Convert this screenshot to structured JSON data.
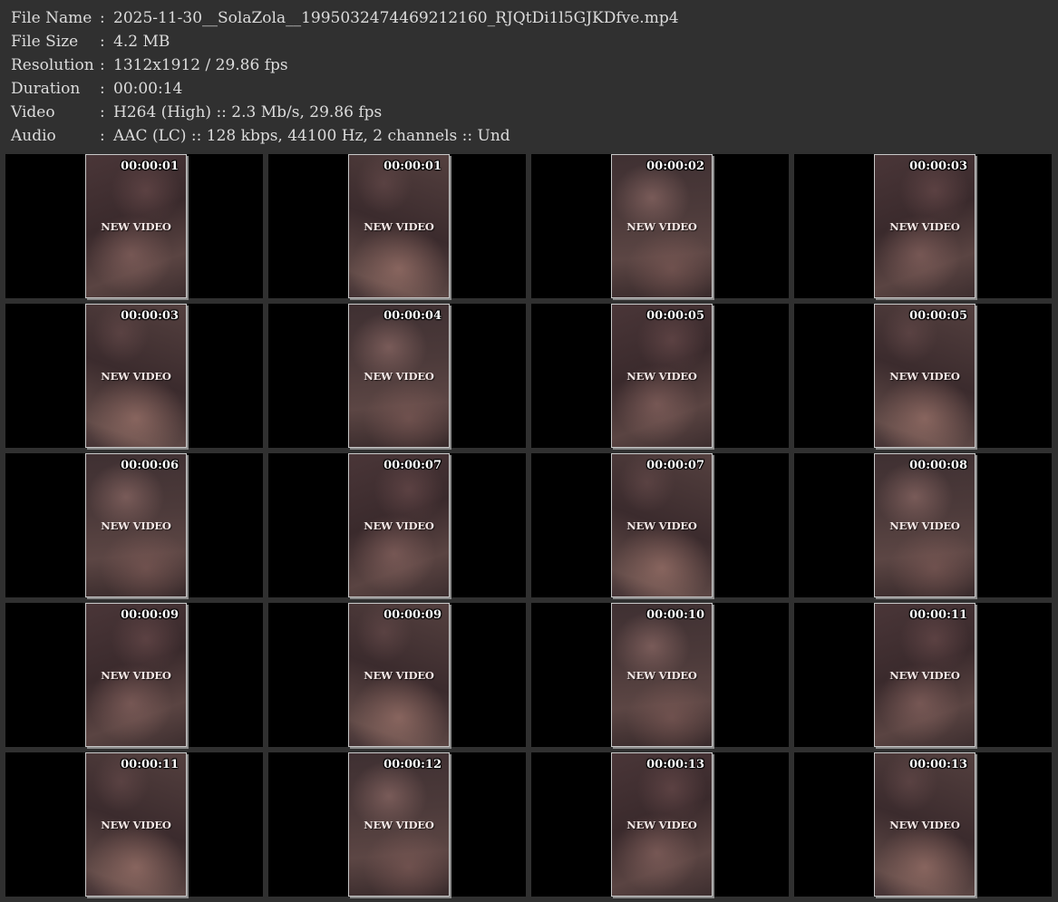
{
  "info": [
    {
      "label": "File Name",
      "sep": ":",
      "value": "2025-11-30__SolaZola__1995032474469212160_RJQtDi1l5GJKDfve.mp4"
    },
    {
      "label": "File Size",
      "sep": ":",
      "value": "4.2 MB"
    },
    {
      "label": "Resolution",
      "sep": ":",
      "value": "1312x1912 / 29.86 fps"
    },
    {
      "label": "Duration",
      "sep": ":",
      "value": "00:00:14"
    },
    {
      "label": "Video",
      "sep": ":",
      "value": "H264 (High) :: 2.3 Mb/s, 29.86 fps"
    },
    {
      "label": "Audio",
      "sep": ":",
      "value": "AAC (LC) :: 128 kbps, 44100 Hz, 2 channels :: Und"
    }
  ],
  "watermark": "NEW VIDEO",
  "thumbnails": [
    {
      "time": "00:00:01"
    },
    {
      "time": "00:00:01"
    },
    {
      "time": "00:00:02"
    },
    {
      "time": "00:00:03"
    },
    {
      "time": "00:00:03"
    },
    {
      "time": "00:00:04"
    },
    {
      "time": "00:00:05"
    },
    {
      "time": "00:00:05"
    },
    {
      "time": "00:00:06"
    },
    {
      "time": "00:00:07"
    },
    {
      "time": "00:00:07"
    },
    {
      "time": "00:00:08"
    },
    {
      "time": "00:00:09"
    },
    {
      "time": "00:00:09"
    },
    {
      "time": "00:00:10"
    },
    {
      "time": "00:00:11"
    },
    {
      "time": "00:00:11"
    },
    {
      "time": "00:00:12"
    },
    {
      "time": "00:00:13"
    },
    {
      "time": "00:00:13"
    }
  ],
  "colors": {
    "background": "#303030",
    "cell": "#000000",
    "text": "#dcdcdc",
    "thumb_border": "#c8c8c8"
  }
}
